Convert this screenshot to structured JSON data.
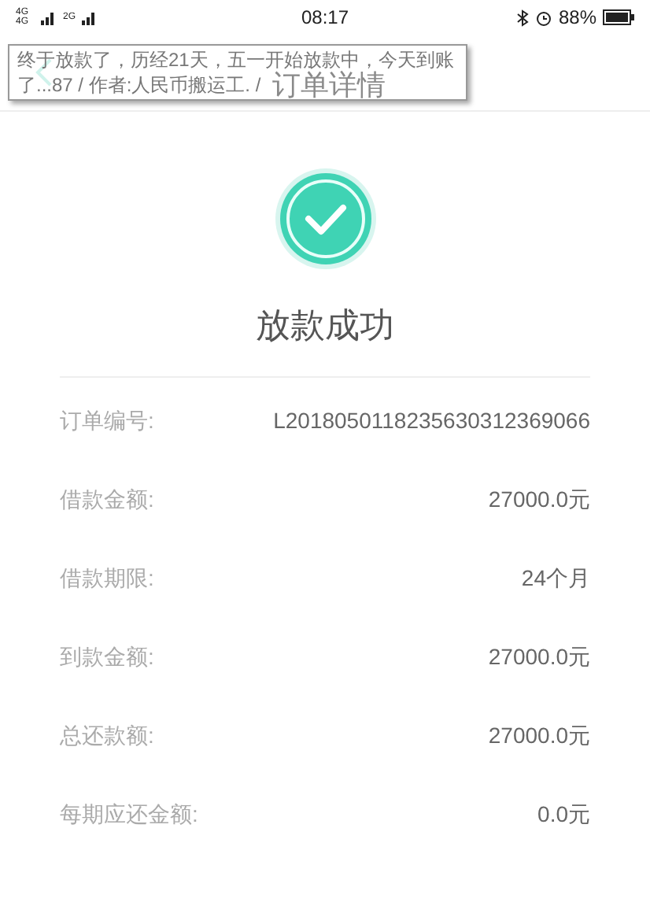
{
  "status_bar": {
    "network_1": "4G 4G",
    "network_2": "2G",
    "time": "08:17",
    "battery": "88%"
  },
  "header": {
    "title": "订单详情"
  },
  "tooltip": {
    "text": "终于放款了，历经21天，五一开始放款中，今天到账了...87 / 作者:人民币搬运工. /"
  },
  "result": {
    "title": "放款成功"
  },
  "details": [
    {
      "label": "订单编号:",
      "value": "L2018050118235630312369066"
    },
    {
      "label": "借款金额:",
      "value": "27000.0元"
    },
    {
      "label": "借款期限:",
      "value": "24个月"
    },
    {
      "label": "到款金额:",
      "value": "27000.0元"
    },
    {
      "label": "总还款额:",
      "value": "27000.0元"
    },
    {
      "label": "每期应还金额:",
      "value": "0.0元"
    }
  ]
}
